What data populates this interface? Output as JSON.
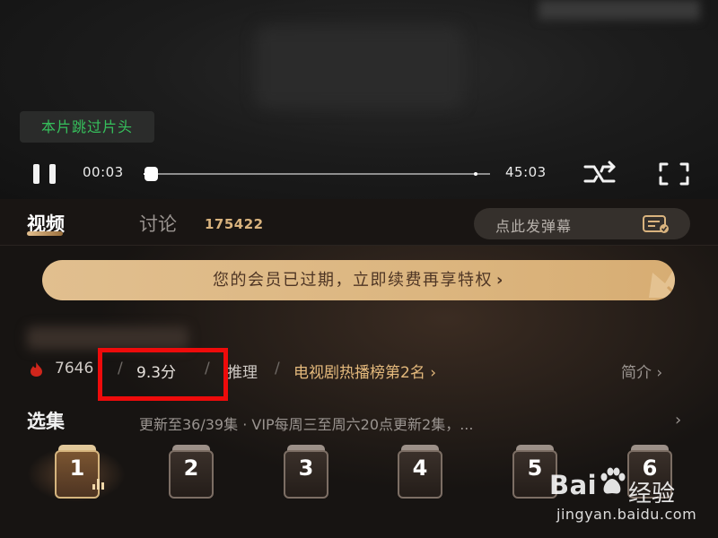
{
  "player": {
    "skip_intro": "本片跳过片头",
    "current_time": "00:03",
    "total_time": "45:03",
    "progress": 0.002
  },
  "tabs": {
    "video_label": "视频",
    "comments_label": "讨论",
    "comments_count": "175422",
    "danmu_placeholder": "点此发弹幕"
  },
  "vip_banner": {
    "text": "您的会员已过期，立即续费再享特权",
    "chevron": "›"
  },
  "meta": {
    "heat": "7646",
    "score": "9.3分",
    "genre": "推理",
    "rank": "电视剧热播榜第2名 ›",
    "intro": "简介 ›",
    "separator": "/"
  },
  "episodes": {
    "title": "选集",
    "update_info": "更新至36/39集 · VIP每周三至周六20点更新2集，...",
    "more": "›",
    "items": [
      "1",
      "2",
      "3",
      "4",
      "5",
      "6"
    ],
    "active_index": 0
  },
  "watermark": {
    "logo": "Bai",
    "suffix": "经验",
    "url": "jingyan.baidu.com"
  },
  "colors": {
    "accent_gold": "#e1bf8f",
    "skip_green": "#36c05c",
    "highlight_red": "#ee0b0b",
    "rank_gold": "#e4b97c"
  }
}
